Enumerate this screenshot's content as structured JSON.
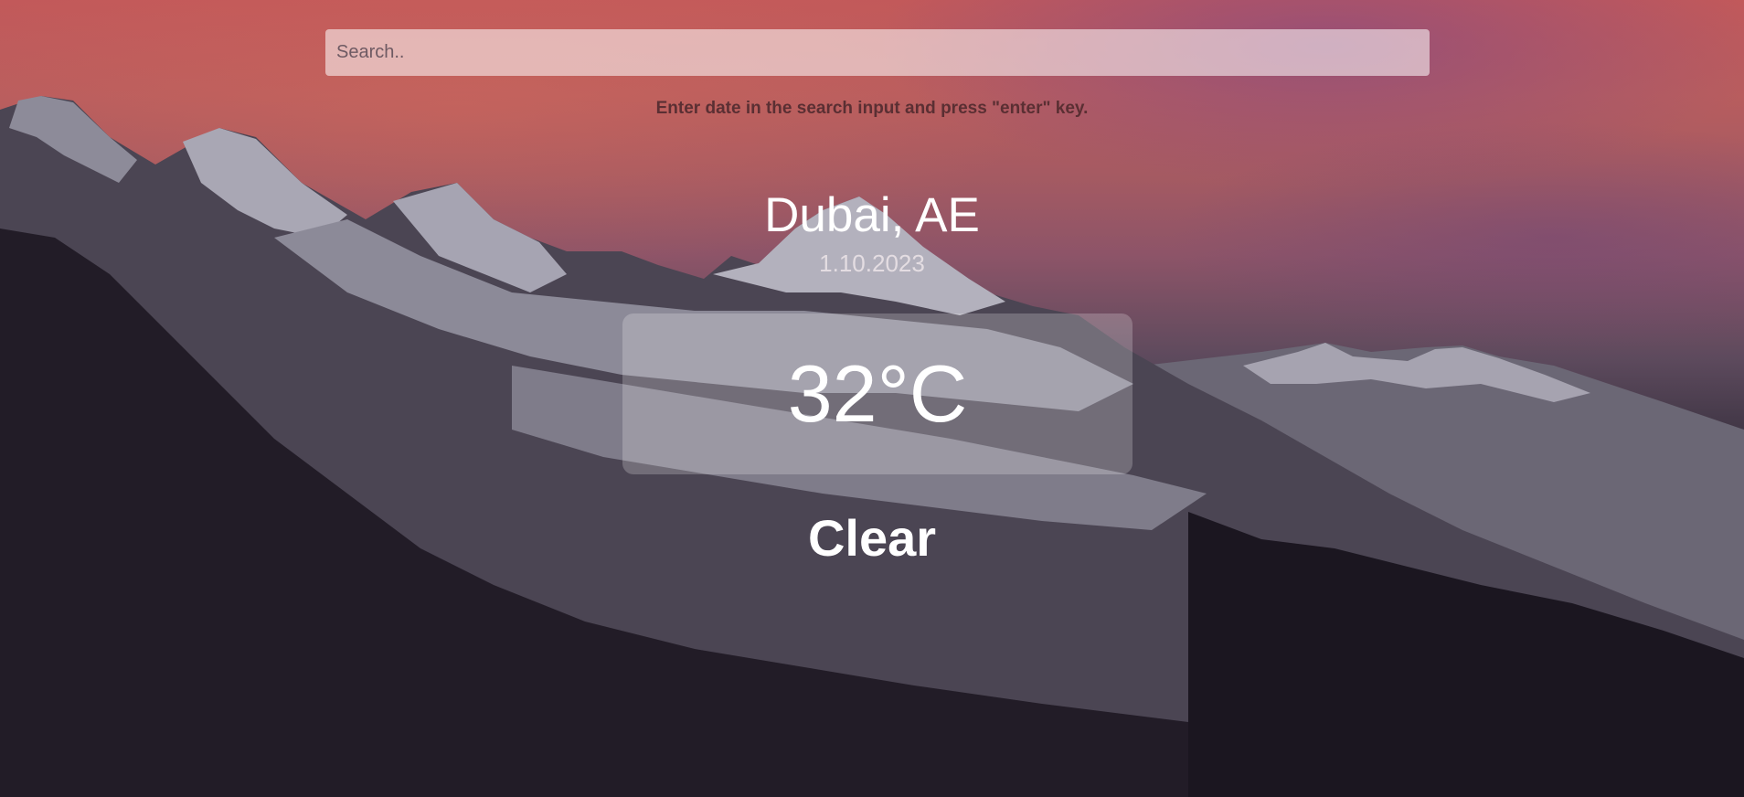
{
  "search": {
    "placeholder": "Search..",
    "value": ""
  },
  "hint": "Enter date in the search input and press \"enter\" key.",
  "location": {
    "city": "Dubai, AE",
    "date": "1.10.2023"
  },
  "weather": {
    "temperature": "32°C",
    "condition": "Clear"
  },
  "colors": {
    "sky_top": "#c2595a",
    "sky_mid": "#8d5468",
    "ground": "#14121a",
    "hint_text": "#5a2f33",
    "text": "#ffffff"
  }
}
